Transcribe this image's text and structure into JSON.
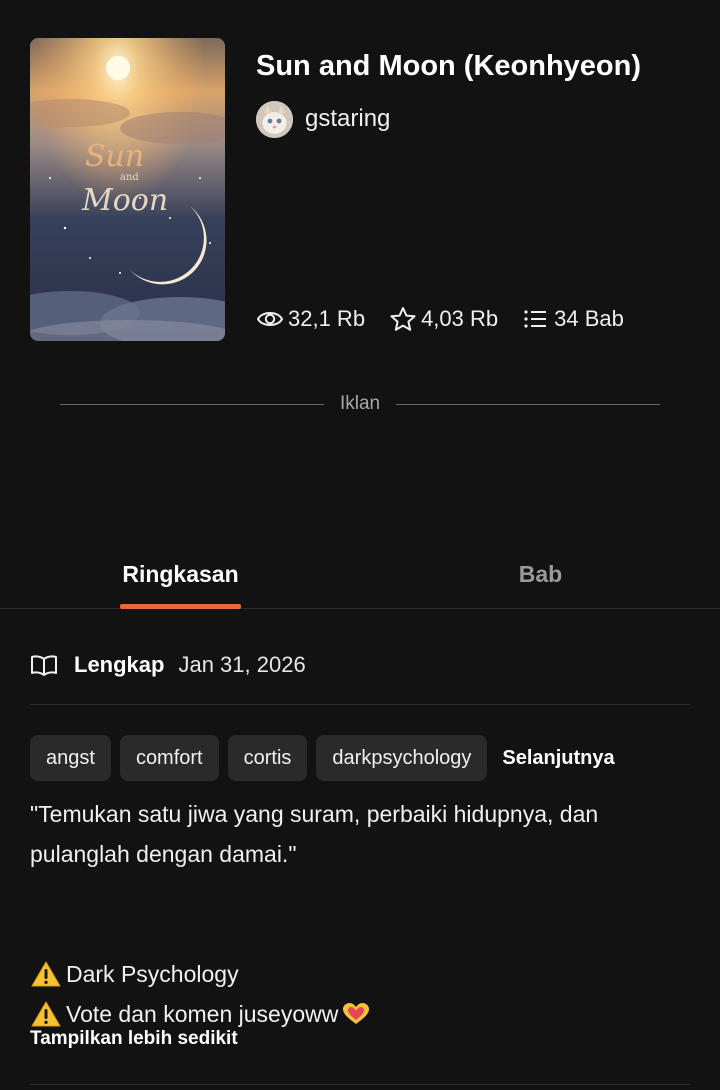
{
  "book": {
    "title": "Sun and Moon (Keonhyeon)",
    "author": "gstaring",
    "cover_text": {
      "line1": "Sun",
      "line2": "and",
      "line3": "Moon"
    },
    "stats": {
      "reads": "32,1 Rb",
      "votes": "4,03 Rb",
      "parts": "34 Bab"
    }
  },
  "ad": {
    "label": "Iklan"
  },
  "tabs": {
    "summary": "Ringkasan",
    "chapters": "Bab"
  },
  "details": {
    "status": "Lengkap",
    "date": "Jan 31, 2026"
  },
  "tags": {
    "items": [
      "angst",
      "comfort",
      "cortis",
      "darkpsychology"
    ],
    "more_label": "Selanjutnya"
  },
  "description": {
    "quote": "\"Temukan satu jiwa yang suram, perbaiki hidupnya, dan pulanglah dengan damai.\"",
    "warning1": "Dark Psychology",
    "warning2": "Vote dan komen juseyoww"
  },
  "show_less_label": "Tampilkan lebih sedikit",
  "colors": {
    "background": "#121212",
    "tab_accent": "#e8673c",
    "tag_background": "#2a2a2a"
  },
  "icons": [
    "eye-icon",
    "star-icon",
    "list-icon",
    "book-icon",
    "warning-icon",
    "heart-hands-icon"
  ]
}
